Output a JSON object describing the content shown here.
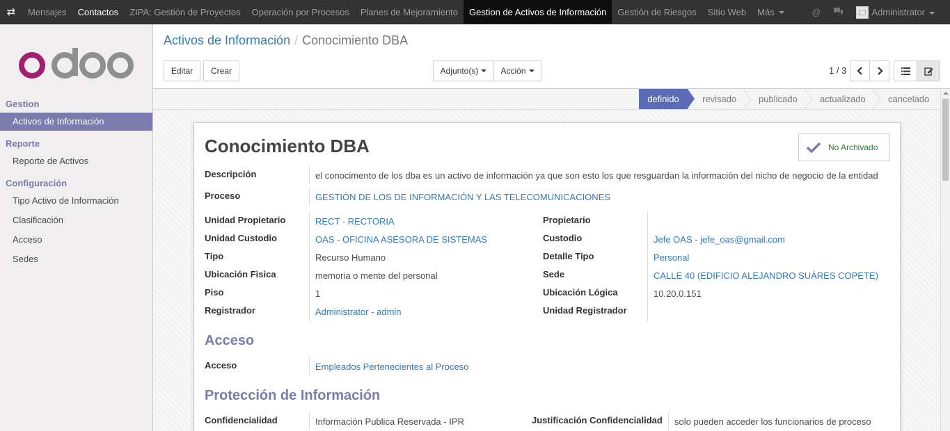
{
  "topbar": {
    "menu": [
      "Mensajes",
      "Contactos",
      "ZIPA: Gestión de Proyectos",
      "Operación por Procesos",
      "Planes de Mejoramiento",
      "Gestion de Activos de Información",
      "Gestión de Riesgos",
      "Sitio Web",
      "Más"
    ],
    "user": "Administrator"
  },
  "sidebar": {
    "sections": [
      {
        "title": "Gestion",
        "items": [
          "Activos de Información"
        ]
      },
      {
        "title": "Reporte",
        "items": [
          "Reporte de Activos"
        ]
      },
      {
        "title": "Configuración",
        "items": [
          "Tipo Activo de Información",
          "Clasificación",
          "Acceso",
          "Sedes"
        ]
      }
    ]
  },
  "breadcrumb": {
    "parent": "Activos de Información",
    "sep": "/",
    "current": "Conocimiento DBA"
  },
  "buttons": {
    "edit": "Editar",
    "create": "Crear",
    "attachments": "Adjunto(s)",
    "action": "Acción"
  },
  "pager": {
    "text": "1 / 3"
  },
  "stages": [
    "definido",
    "revisado",
    "publicado",
    "actualizado",
    "cancelado"
  ],
  "form": {
    "title": "Conocimiento DBA",
    "archive_label": "No Archivado",
    "descripcion_label": "Descripción",
    "descripcion": "el conocimento de los dba es un activo de información ya que son esto los que resguardan la información del nicho de negocio de la entidad",
    "proceso_label": "Proceso",
    "proceso": "GESTIÓN DE LOS DE INFORMACIÓN Y LAS TELECOMUNICACIONES",
    "left_fields": [
      {
        "label": "Unidad Propietario",
        "value": "RECT - RECTORIA",
        "link": true
      },
      {
        "label": "Unidad Custodio",
        "value": "OAS - OFICINA ASESORA DE SISTEMAS",
        "link": true
      },
      {
        "label": "Tipo",
        "value": "Recurso Humano",
        "link": false
      },
      {
        "label": "Ubicación Fisica",
        "value": "memoria o mente del personal",
        "link": false
      },
      {
        "label": "Piso",
        "value": "1",
        "link": false
      },
      {
        "label": "Registrador",
        "value": "Administrator - admin",
        "link": true
      }
    ],
    "right_fields": [
      {
        "label": "Propietario",
        "value": "",
        "link": false
      },
      {
        "label": "Custodio",
        "value": "Jefe OAS - jefe_oas@gmail.com",
        "link": true
      },
      {
        "label": "Detalle Tipo",
        "value": "Personal",
        "link": true
      },
      {
        "label": "Sede",
        "value": "CALLE 40 (EDIFICIO ALEJANDRO SUÁRES COPETE)",
        "link": true
      },
      {
        "label": "Ubicación Lógica",
        "value": "10.20.0.151",
        "link": false
      },
      {
        "label": "Unidad Registrador",
        "value": "",
        "link": false
      }
    ],
    "acceso_title": "Acceso",
    "acceso_label": "Acceso",
    "acceso_value": "Empleados Pertenecientes al Proceso",
    "proteccion_title": "Protección de Información",
    "confidencialidad_label": "Confidencialidad",
    "confidencialidad_value": "Información Publica Reservada - IPR",
    "justificacion_label": "Justificación Confidencialidad",
    "justificacion_value": "solo pueden acceder los funcionarios de proceso"
  },
  "colors": {
    "accent": "#7c7bad",
    "link": "#337ab7",
    "stage_active": "#5c6bb8",
    "topbar": "#333333"
  }
}
